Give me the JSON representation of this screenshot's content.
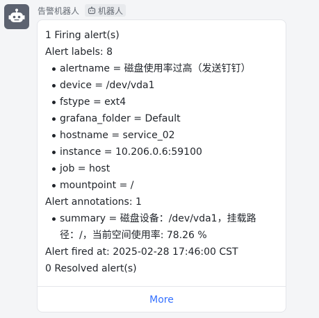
{
  "sender": {
    "name": "告警机器人",
    "tag_label": "机器人",
    "avatar_icon": "robot-icon",
    "tag_icon": "robot-icon"
  },
  "card": {
    "firing_summary": "1 Firing alert(s)",
    "labels_header": "Alert labels: 8",
    "labels": [
      "alertname = 磁盘使用率过高（发送钉钉）",
      "device = /dev/vda1",
      "fstype = ext4",
      "grafana_folder = Default",
      "hostname = service_02",
      "instance = 10.206.0.6:59100",
      "job = host",
      "mountpoint = /"
    ],
    "annotations_header": "Alert annotations: 1",
    "annotations": [
      "summary = 磁盘设备：/dev/vda1，挂载路径：/，当前空间使用率: 78.26 %"
    ],
    "fired_at": "Alert fired at: 2025-02-28 17:46:00 CST",
    "resolved_summary": "0 Resolved alert(s)",
    "more_label": "More"
  },
  "colors": {
    "link": "#3370ff",
    "avatar_bg": "#5c6270",
    "text": "#1f2329"
  }
}
